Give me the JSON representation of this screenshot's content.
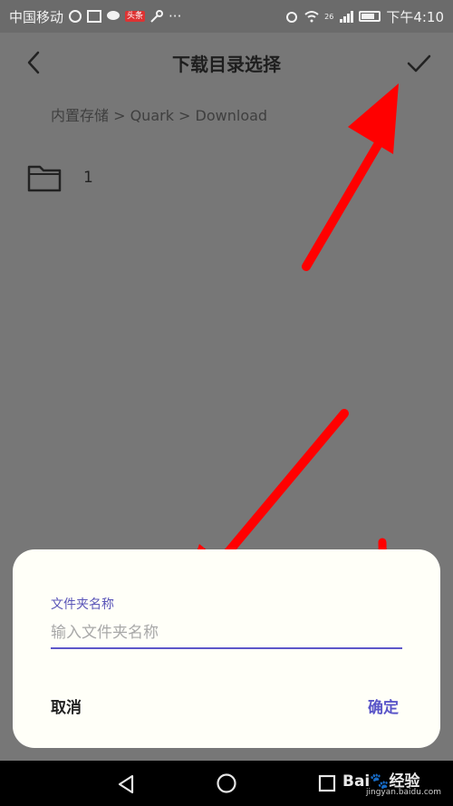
{
  "status_bar": {
    "carrier": "中国移动",
    "badge": "头条",
    "time": "下午4:10",
    "signal_label": "26"
  },
  "header": {
    "title": "下载目录选择"
  },
  "breadcrumb": "内置存储 > Quark > Download",
  "folders": [
    {
      "name": "1"
    }
  ],
  "dialog": {
    "label": "文件夹名称",
    "placeholder": "输入文件夹名称",
    "value": "",
    "cancel": "取消",
    "ok": "确定"
  },
  "watermark": {
    "text": "Bai",
    "text2": "经验",
    "sub": "jingyan.baidu.com"
  },
  "colors": {
    "accent": "#5a55c8",
    "overlay": "#777777",
    "annotation_arrow": "#ff0000"
  }
}
